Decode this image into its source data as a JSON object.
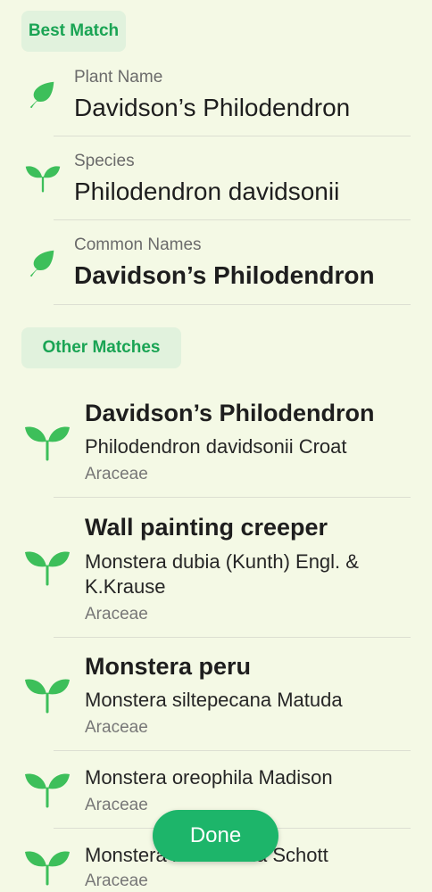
{
  "best_match": {
    "header": "Best Match",
    "rows": [
      {
        "label": "Plant Name",
        "value": "Davidson’s Philodendron",
        "icon": "leaf-icon"
      },
      {
        "label": "Species",
        "value": "Philodendron davidsonii",
        "icon": "sprout-icon"
      },
      {
        "label": "Common Names",
        "value": "Davidson’s Philodendron",
        "icon": "leaf-icon"
      }
    ]
  },
  "other_matches": {
    "header": "Other Matches",
    "items": [
      {
        "title": "Davidson’s Philodendron",
        "scientific": "Philodendron davidsonii Croat",
        "family": "Araceae"
      },
      {
        "title": "Wall painting creeper",
        "scientific": "Monstera dubia (Kunth) Engl. & K.Krause",
        "family": "Araceae"
      },
      {
        "title": "Monstera peru",
        "scientific": "Monstera siltepecana Matuda",
        "family": "Araceae"
      },
      {
        "title": "",
        "scientific": "Monstera oreophila Madison",
        "family": "Araceae"
      },
      {
        "title": "",
        "scientific": "Monstera lechleriana Schott",
        "family": "Araceae"
      }
    ]
  },
  "done_label": "Done",
  "colors": {
    "accent": "#1db56a",
    "chip_bg": "#e1f2dd",
    "chip_text": "#1aa454",
    "icon_green": "#3dbf5a",
    "background": "#f4f9e5"
  }
}
